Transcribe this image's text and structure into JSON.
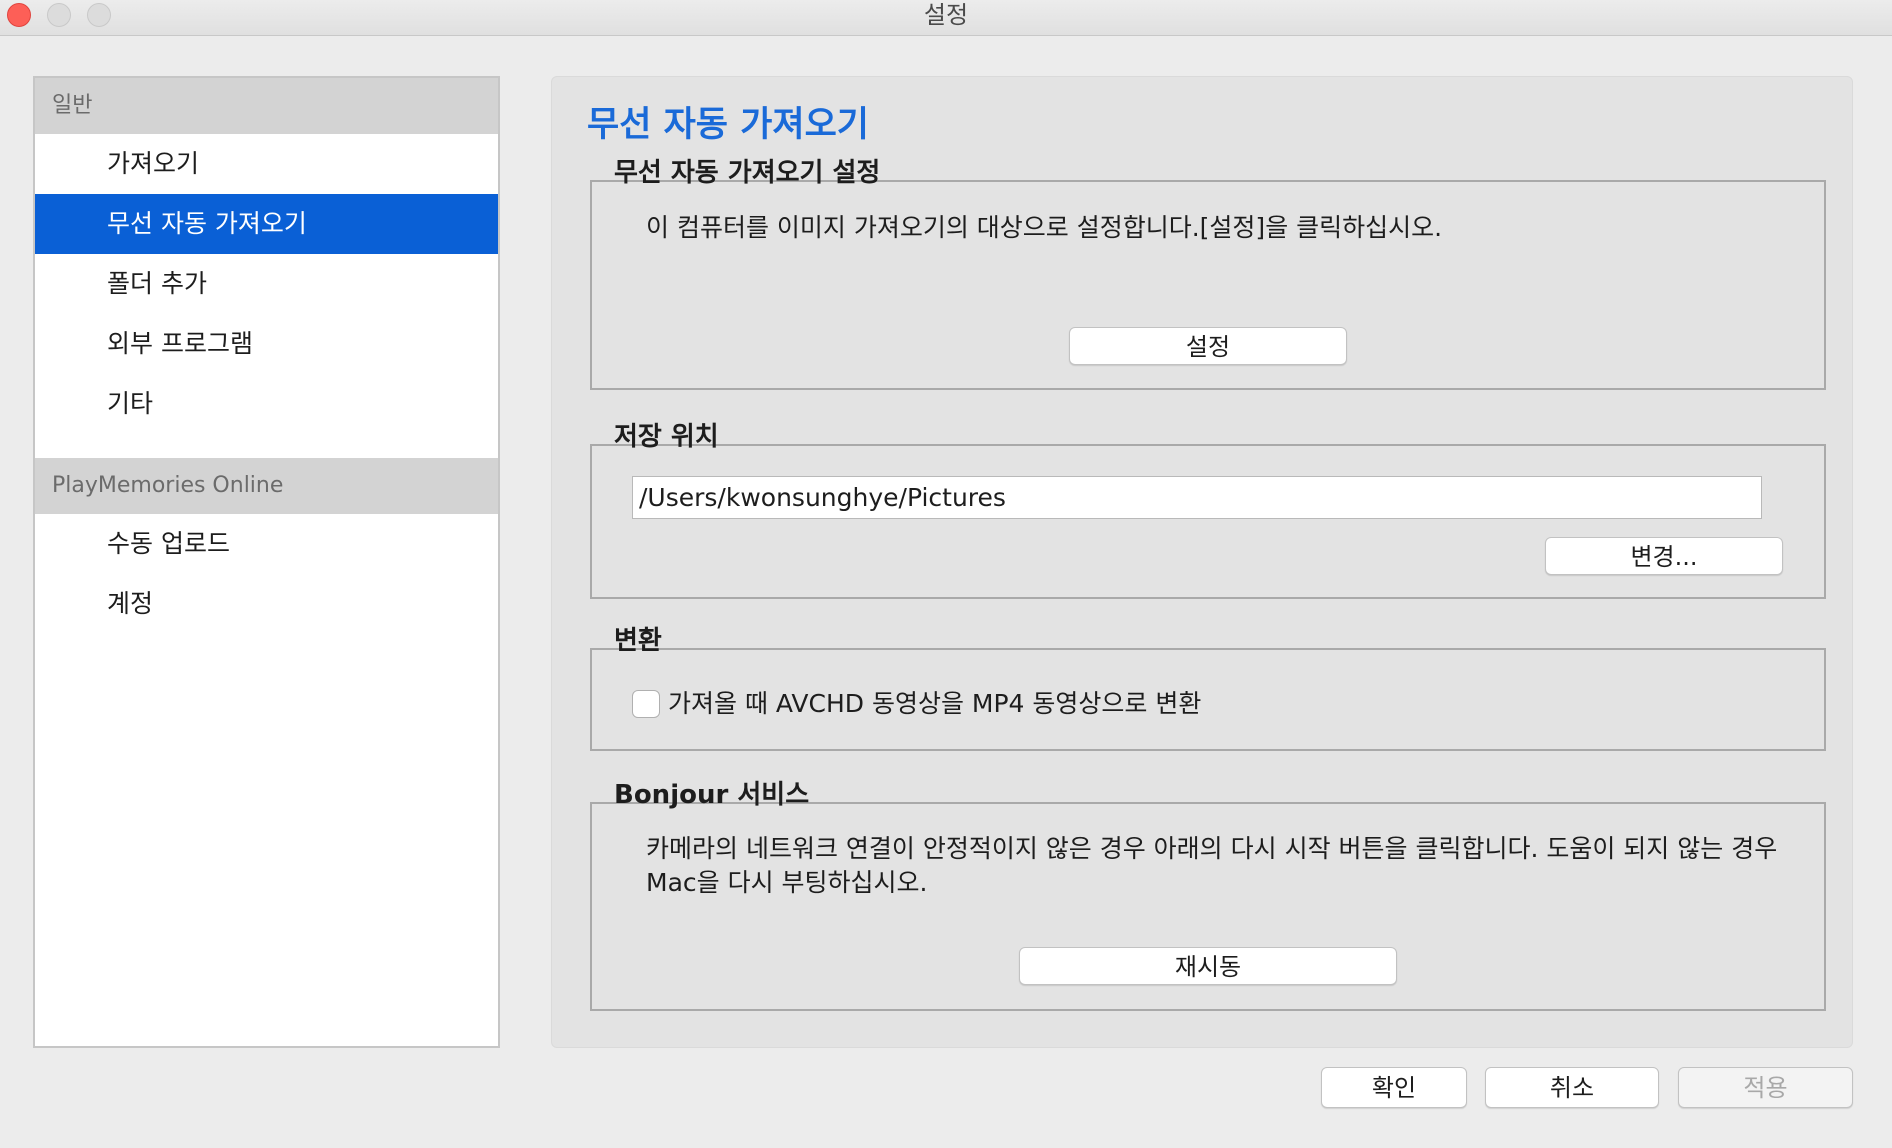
{
  "window": {
    "title": "설정"
  },
  "sidebar": {
    "sections": [
      {
        "header": "일반",
        "items": [
          {
            "label": "가져오기"
          },
          {
            "label": "무선 자동 가져오기",
            "selected": true
          },
          {
            "label": "폴더 추가"
          },
          {
            "label": "외부 프로그램"
          },
          {
            "label": "기타"
          }
        ]
      },
      {
        "header": "PlayMemories Online",
        "items": [
          {
            "label": "수동 업로드"
          },
          {
            "label": "계정"
          }
        ]
      }
    ]
  },
  "main": {
    "title": "무선 자동 가져오기",
    "wireless_settings": {
      "group_title": "무선 자동 가져오기 설정",
      "description": "이 컴퓨터를 이미지 가져오기의 대상으로 설정합니다.[설정]을 클릭하십시오.",
      "button_label": "설정"
    },
    "save_location": {
      "group_title": "저장 위치",
      "path": "/Users/kwonsunghye/Pictures",
      "change_button_label": "변경..."
    },
    "conversion": {
      "group_title": "변환",
      "checkbox_label": "가져올 때 AVCHD 동영상을 MP4 동영상으로 변환",
      "checked": false
    },
    "bonjour": {
      "group_title": "Bonjour 서비스",
      "description_line1": "카메라의 네트워크 연결이 안정적이지 않은 경우 아래의 다시 시작 버튼을 클릭합니다. 도움이 되지 않는 경우",
      "description_line2": "Mac을 다시 부팅하십시오.",
      "restart_button_label": "재시동"
    }
  },
  "footer": {
    "ok_label": "확인",
    "cancel_label": "취소",
    "apply_label": "적용",
    "apply_enabled": false
  },
  "colors": {
    "accent": "#0a60d6",
    "title_blue": "#1a6ad8",
    "close_red": "#fd5f57"
  }
}
